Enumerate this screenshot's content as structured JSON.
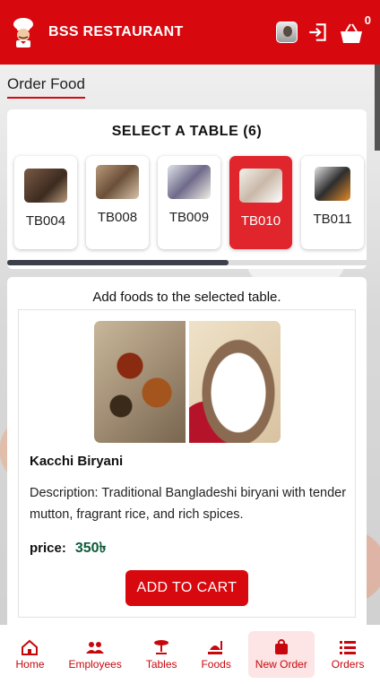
{
  "header": {
    "title": "BSS RESTAURANT",
    "cart_count": "0"
  },
  "page": {
    "section_title": "Order Food"
  },
  "table_select": {
    "heading": "SELECT A TABLE (6)",
    "tables": [
      {
        "label": "TB004",
        "selected": false
      },
      {
        "label": "TB008",
        "selected": false
      },
      {
        "label": "TB009",
        "selected": false
      },
      {
        "label": "TB010",
        "selected": true
      },
      {
        "label": "TB011",
        "selected": false
      }
    ]
  },
  "food": {
    "hint": "Add foods to the selected table.",
    "name": "Kacchi Biryani",
    "description": "Description: Traditional Bangladeshi biryani with tender mutton, fragrant rice, and rich spices.",
    "price_label": "price:",
    "price_value": "350৳",
    "add_button": "ADD TO CART"
  },
  "nav": {
    "items": [
      {
        "label": "Home",
        "icon": "home-icon"
      },
      {
        "label": "Employees",
        "icon": "people-icon"
      },
      {
        "label": "Tables",
        "icon": "table-icon"
      },
      {
        "label": "Foods",
        "icon": "food-icon"
      },
      {
        "label": "New Order",
        "icon": "shopping-bag-icon",
        "active": true
      },
      {
        "label": "Orders",
        "icon": "list-icon"
      }
    ]
  },
  "colors": {
    "brand_red": "#d7090f",
    "selected_tile": "#e0262c",
    "price_green": "#0d5a38"
  }
}
